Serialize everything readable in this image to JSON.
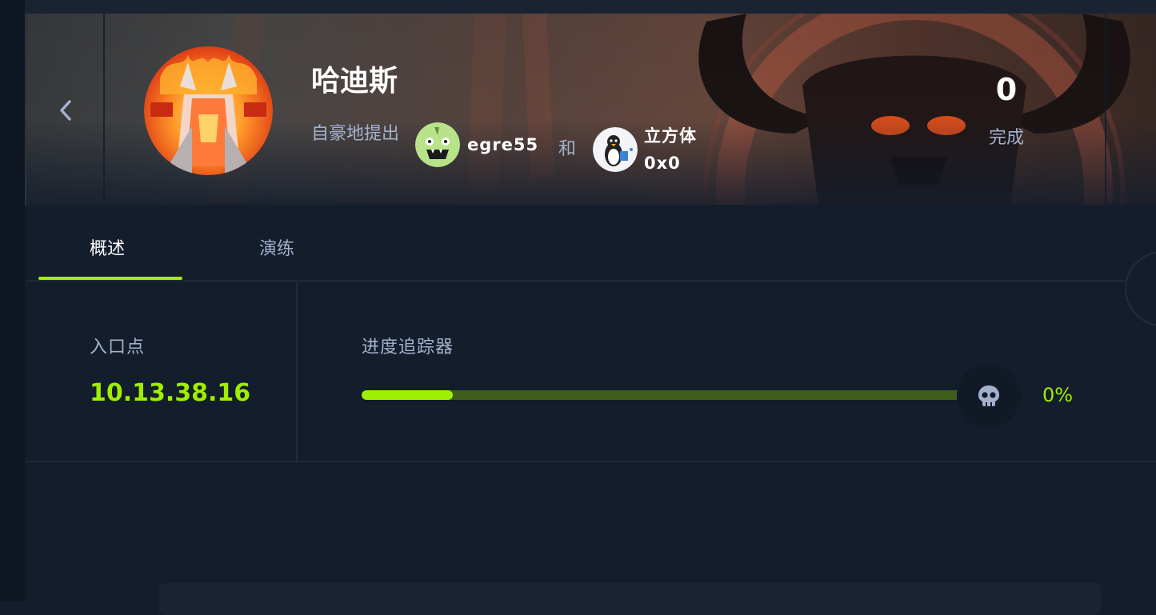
{
  "machine": {
    "name": "哈迪斯",
    "submitted_label": "自豪地提出",
    "and_label": "和"
  },
  "authors": [
    {
      "name": "egre55",
      "avatar_icon": "cartoon-monster-avatar"
    },
    {
      "name": "立方体",
      "subtitle": "0x0",
      "avatar_icon": "linux-penguin-avatar"
    }
  ],
  "owns": {
    "count": "0",
    "label": "完成"
  },
  "tabs": [
    {
      "label": "概述",
      "active": true
    },
    {
      "label": "演练",
      "active": false
    }
  ],
  "entry_point": {
    "label": "入口点",
    "value": "10.13.38.16"
  },
  "progress": {
    "label": "进度追踪器",
    "percent_text": "0%",
    "fill_fraction": 0.15,
    "icon": "skull-icon"
  },
  "colors": {
    "accent": "#9fef00",
    "background": "#141d2b",
    "muted_text": "#a4b1cd",
    "track": "#3f5e1c"
  }
}
